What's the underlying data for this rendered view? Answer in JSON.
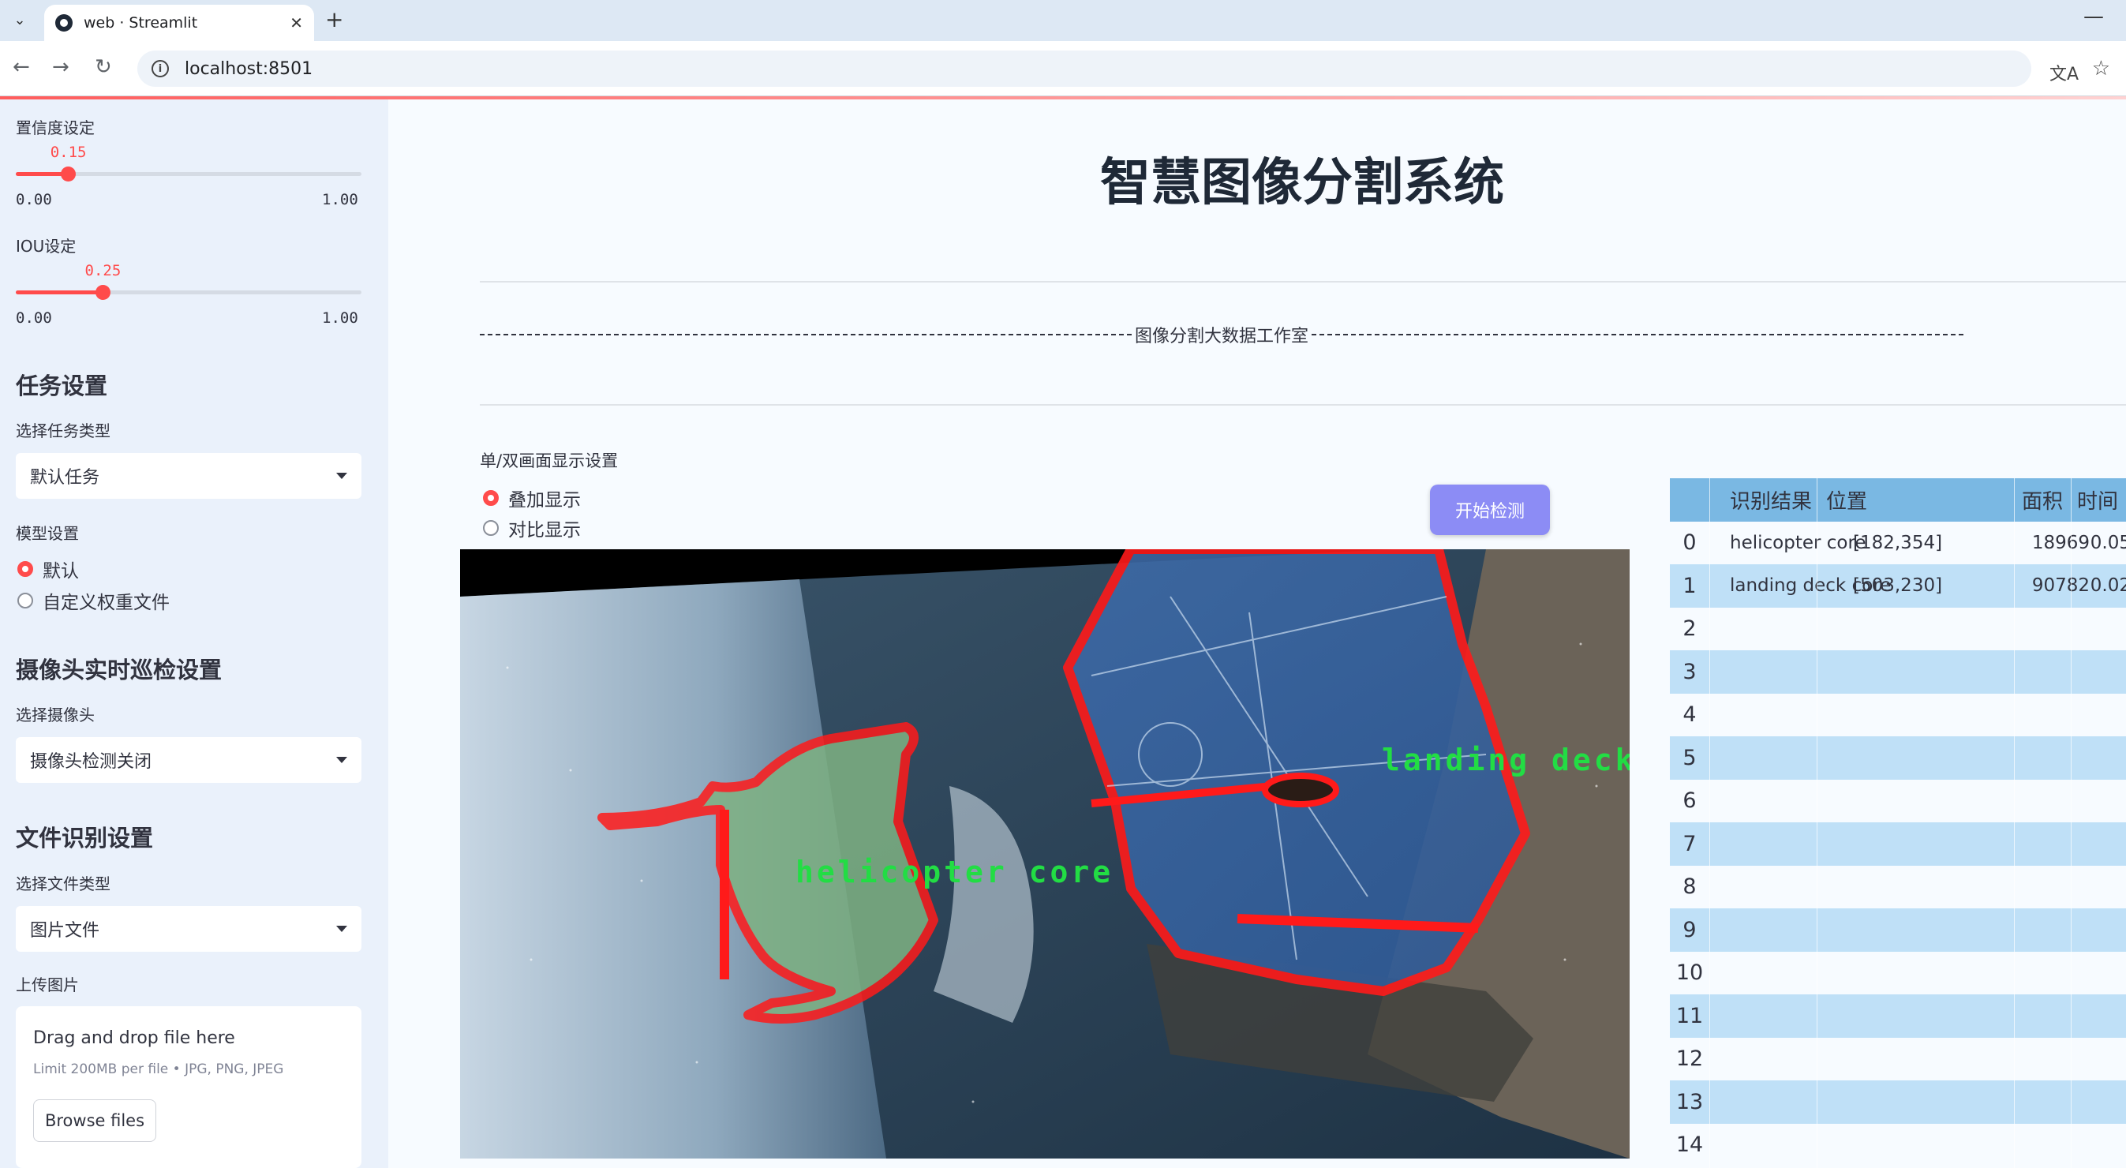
{
  "browser": {
    "tab_title": "web · Streamlit",
    "url": "localhost:8501"
  },
  "sidebar": {
    "conf_label": "置信度设定",
    "conf_value": "0.15",
    "conf_min": "0.00",
    "conf_max": "1.00",
    "conf_fraction": 0.15,
    "iou_label": "IOU设定",
    "iou_value": "0.25",
    "iou_min": "0.00",
    "iou_max": "1.00",
    "iou_fraction": 0.25,
    "task_heading": "任务设置",
    "task_type_label": "选择任务类型",
    "task_type_value": "默认任务",
    "model_label": "模型设置",
    "model_options": [
      "默认",
      "自定义权重文件"
    ],
    "camera_heading": "摄像头实时巡检设置",
    "camera_label": "选择摄像头",
    "camera_value": "摄像头检测关闭",
    "file_heading": "文件识别设置",
    "file_type_label": "选择文件类型",
    "file_type_value": "图片文件",
    "upload_label": "上传图片",
    "upload_title": "Drag and drop file here",
    "upload_sub": "Limit 200MB per file • JPG, PNG, JPEG",
    "browse_label": "Browse files"
  },
  "main": {
    "title": "智慧图像分割系统",
    "banner": "图像分割大数据工作室",
    "display_mode_label": "单/双画面显示设置",
    "display_options": [
      "叠加显示",
      "对比显示"
    ],
    "detect_button": "开始检测",
    "overlay_labels": [
      "helicopter core",
      "landing deck core"
    ]
  },
  "table": {
    "headers": [
      "识别结果",
      "位置",
      "面积",
      "时间"
    ],
    "rows": [
      {
        "idx": "0",
        "name": "helicopter core",
        "pos": "[182,354]",
        "area": "18969",
        "time": "0.05"
      },
      {
        "idx": "1",
        "name": "landing deck core",
        "pos": "[503,230]",
        "area": "90782",
        "time": "0.02"
      },
      {
        "idx": "2"
      },
      {
        "idx": "3"
      },
      {
        "idx": "4"
      },
      {
        "idx": "5"
      },
      {
        "idx": "6"
      },
      {
        "idx": "7"
      },
      {
        "idx": "8"
      },
      {
        "idx": "9"
      },
      {
        "idx": "10"
      },
      {
        "idx": "11"
      },
      {
        "idx": "12"
      },
      {
        "idx": "13"
      },
      {
        "idx": "14"
      }
    ]
  },
  "colors": {
    "accent": "#ff4b4b",
    "button": "#8c8cf5",
    "table_header": "#7ab8e3",
    "table_alt": "#bfe0f7",
    "mask_outline": "#ff1a1a",
    "label_green": "#22dd44"
  }
}
